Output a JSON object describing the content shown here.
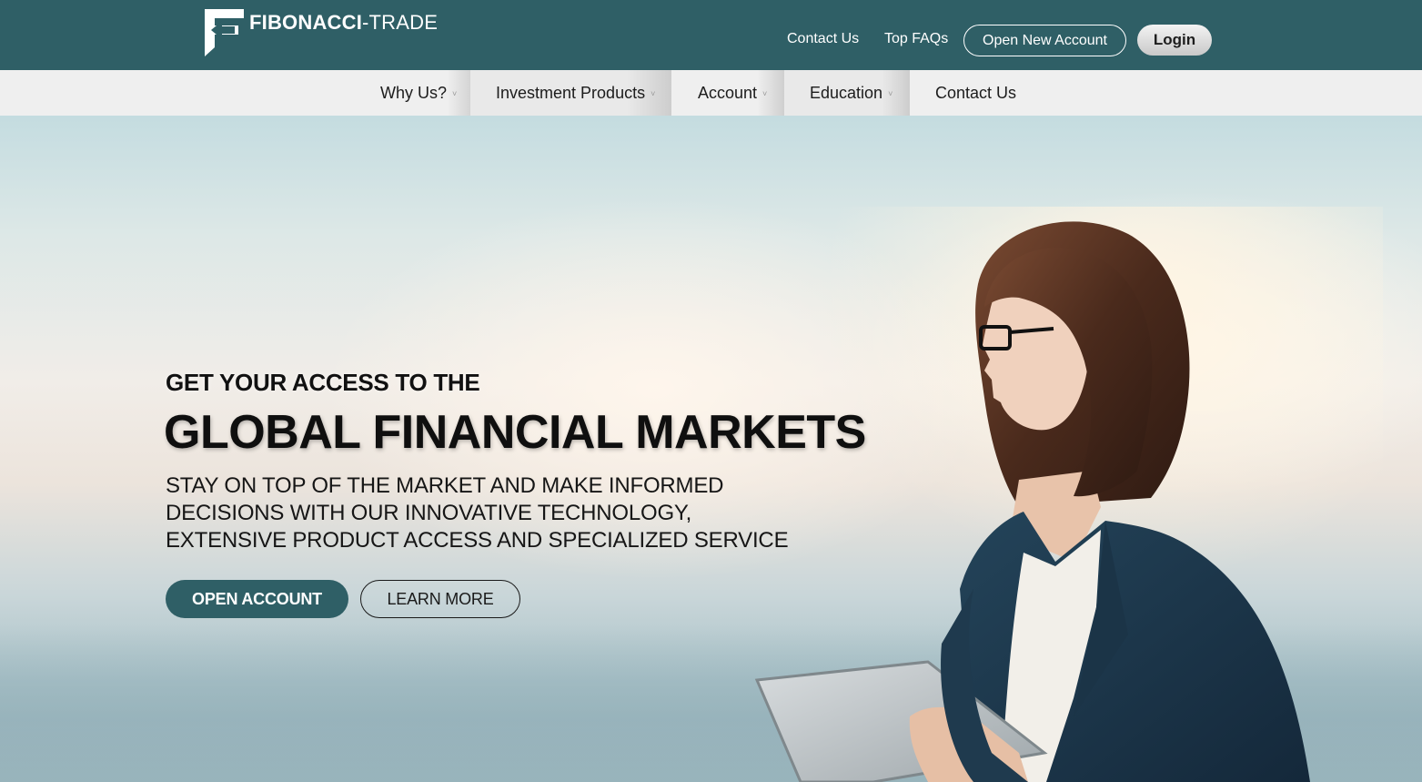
{
  "brand": {
    "name_bold": "FIBONACCI",
    "name_light": "-TRADE",
    "primary_color": "#2f5f66"
  },
  "topbar": {
    "links": [
      {
        "label": "Contact Us"
      },
      {
        "label": "Top FAQs"
      }
    ],
    "open_new_account": "Open New Account",
    "login": "Login"
  },
  "nav": {
    "items": [
      {
        "label": "Why Us?",
        "has_dropdown": true
      },
      {
        "label": "Investment Products",
        "has_dropdown": true
      },
      {
        "label": "Account",
        "has_dropdown": true
      },
      {
        "label": "Education",
        "has_dropdown": true
      },
      {
        "label": "Contact Us",
        "has_dropdown": false
      }
    ],
    "caret_glyph": "˅"
  },
  "hero": {
    "kicker": "GET YOUR ACCESS TO THE",
    "title": "GLOBAL FINANCIAL MARKETS",
    "subtitle_lines": [
      "STAY ON TOP OF THE MARKET AND MAKE INFORMED",
      "DECISIONS WITH OUR INNOVATIVE TECHNOLOGY,",
      "EXTENSIVE PRODUCT ACCESS AND SPECIALIZED SERVICE"
    ],
    "primary_cta": "OPEN ACCOUNT",
    "secondary_cta": "LEARN MORE"
  }
}
